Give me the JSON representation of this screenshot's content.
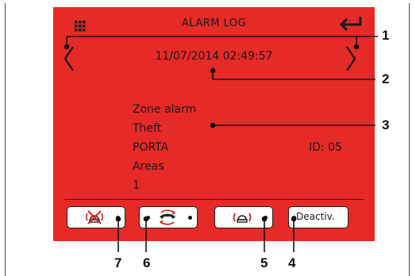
{
  "screen": {
    "title": "ALARM LOG",
    "datetime": "11/07/2014 02:49:57",
    "info": {
      "line1": "Zone alarm",
      "line2": "Theft",
      "line3": "PORTA",
      "id": "ID: 05",
      "line4": "Areas",
      "line5": "1"
    },
    "buttons": {
      "deactivate_label": "Deactiv."
    },
    "icons": {
      "menu": "grid-icon",
      "back": "enter-return-icon",
      "prev": "chevron-left-icon",
      "next": "chevron-right-icon",
      "siren_mute": "siren-muted-icon",
      "phone": "phone-call-icon",
      "siren": "siren-icon"
    },
    "colors": {
      "background": "#e52a27"
    }
  },
  "callouts": [
    "1",
    "2",
    "3",
    "4",
    "5",
    "6",
    "7"
  ]
}
